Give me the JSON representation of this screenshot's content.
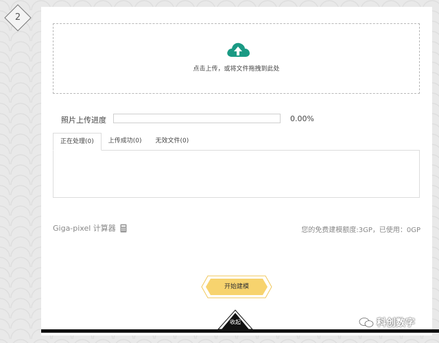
{
  "step": {
    "number": "2"
  },
  "upload": {
    "hint": "点击上传，或将文件拖拽到此处",
    "icon": "cloud-upload-icon",
    "accent": "#1a9a84"
  },
  "progress": {
    "label": "照片上传进度",
    "percent_text": "0.00%",
    "value": 0
  },
  "tabs": [
    {
      "label": "正在处理(0)",
      "active": true
    },
    {
      "label": "上传成功(0)",
      "active": false
    },
    {
      "label": "无效文件(0)",
      "active": false
    }
  ],
  "calculator": {
    "label": "Giga-pixel 计算器",
    "icon": "calculator-icon"
  },
  "quota": {
    "text": "您的免费建模额度:3GP，已使用：0GP"
  },
  "start_button": {
    "label": "开始建模",
    "color": "#f7d36e"
  },
  "collapse": {
    "label": "收起"
  },
  "watermark": {
    "text": "科创数字",
    "icon": "wechat-icon"
  }
}
